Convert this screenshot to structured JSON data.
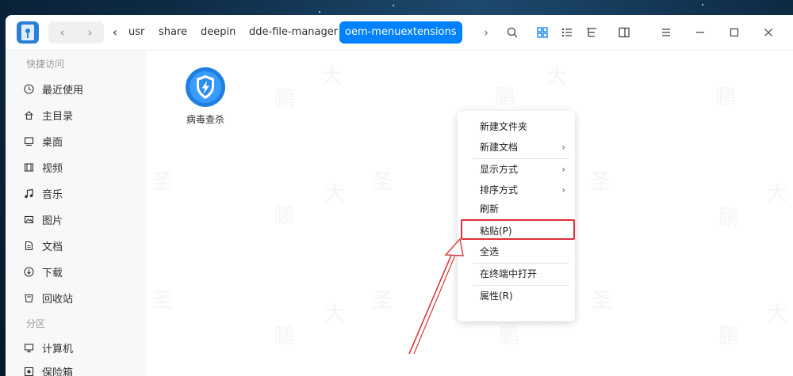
{
  "nav": {
    "back_glyph": "‹",
    "forward_glyph": "›",
    "crumb_back_glyph": "‹",
    "crumb_next_glyph": "›"
  },
  "breadcrumb": [
    {
      "label": "usr",
      "active": false
    },
    {
      "label": "share",
      "active": false
    },
    {
      "label": "deepin",
      "active": false
    },
    {
      "label": "dde-file-manager",
      "active": false
    },
    {
      "label": "oem-menuextensions",
      "active": true
    }
  ],
  "sidebar": {
    "section_quick": "快捷访问",
    "quick_items": [
      {
        "label": "最近使用",
        "icon": "clock-icon"
      },
      {
        "label": "主目录",
        "icon": "home-icon"
      },
      {
        "label": "桌面",
        "icon": "desktop-icon"
      },
      {
        "label": "视频",
        "icon": "video-icon"
      },
      {
        "label": "音乐",
        "icon": "music-icon"
      },
      {
        "label": "图片",
        "icon": "image-icon"
      },
      {
        "label": "文档",
        "icon": "document-icon"
      },
      {
        "label": "下载",
        "icon": "download-icon"
      },
      {
        "label": "回收站",
        "icon": "trash-icon"
      }
    ],
    "section_partition": "分区",
    "partition_items": [
      {
        "label": "计算机",
        "icon": "computer-icon"
      },
      {
        "label": "保险箱",
        "icon": "safe-icon"
      }
    ]
  },
  "files": [
    {
      "label": "病毒查杀",
      "icon": "antivirus-shield-icon"
    }
  ],
  "context_menu": {
    "items": [
      {
        "label": "新建文件夹",
        "submenu": false
      },
      {
        "label": "新建文档",
        "submenu": true
      },
      {
        "label": "显示方式",
        "submenu": true
      },
      {
        "label": "排序方式",
        "submenu": true
      },
      {
        "label": "刷新",
        "submenu": false
      },
      {
        "label": "粘贴(P)",
        "submenu": false,
        "highlighted": true
      },
      {
        "label": "全选",
        "submenu": false
      },
      {
        "label": "在终端中打开",
        "submenu": false
      },
      {
        "label": "属性(R)",
        "submenu": false
      }
    ],
    "submenu_glyph": "›"
  },
  "watermark": [
    "鹏",
    "大",
    "圣"
  ],
  "colors": {
    "accent": "#0081ff",
    "highlight_box": "#e0303a",
    "annotation_arrow": "#d83a3a",
    "sidebar_bg": "#f7f8fa"
  }
}
